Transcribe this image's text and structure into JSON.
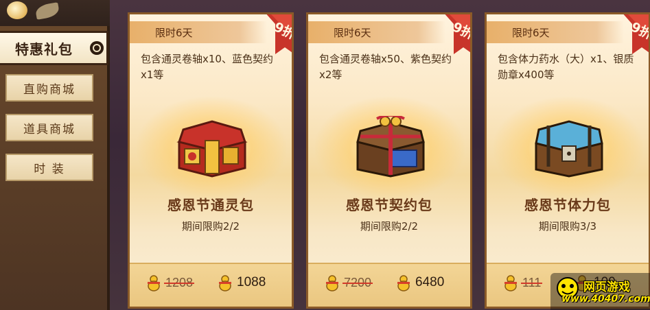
{
  "sidebar": {
    "active_tab": "特惠礼包",
    "items": [
      {
        "label": "直购商城"
      },
      {
        "label": "道具商城"
      },
      {
        "label": "时 装"
      }
    ]
  },
  "cards": [
    {
      "ribbon": "限时6天",
      "discount": "9折",
      "desc": "包含通灵卷轴x10、蓝色契约x1等",
      "name": "感恩节通灵包",
      "limit": "期间限购2/2",
      "old_price": "1208",
      "new_price": "1088"
    },
    {
      "ribbon": "限时6天",
      "discount": "9折",
      "desc": "包含通灵卷轴x50、紫色契约x2等",
      "name": "感恩节契约包",
      "limit": "期间限购2/2",
      "old_price": "7200",
      "new_price": "6480"
    },
    {
      "ribbon": "限时6天",
      "discount": "9折",
      "desc": "包含体力药水（大）x1、银质勋章x400等",
      "name": "感恩节体力包",
      "limit": "期间限购3/3",
      "old_price": "111",
      "new_price": "100"
    }
  ],
  "watermark": {
    "title": "网页游戏",
    "url": "www.40407.com"
  },
  "colors": {
    "card_border": "#8a5a28",
    "ribbon": "#e8b06a",
    "discount_tag": "#c8342a",
    "strike": "#d23a2a",
    "name_text": "#6a3a1a"
  }
}
